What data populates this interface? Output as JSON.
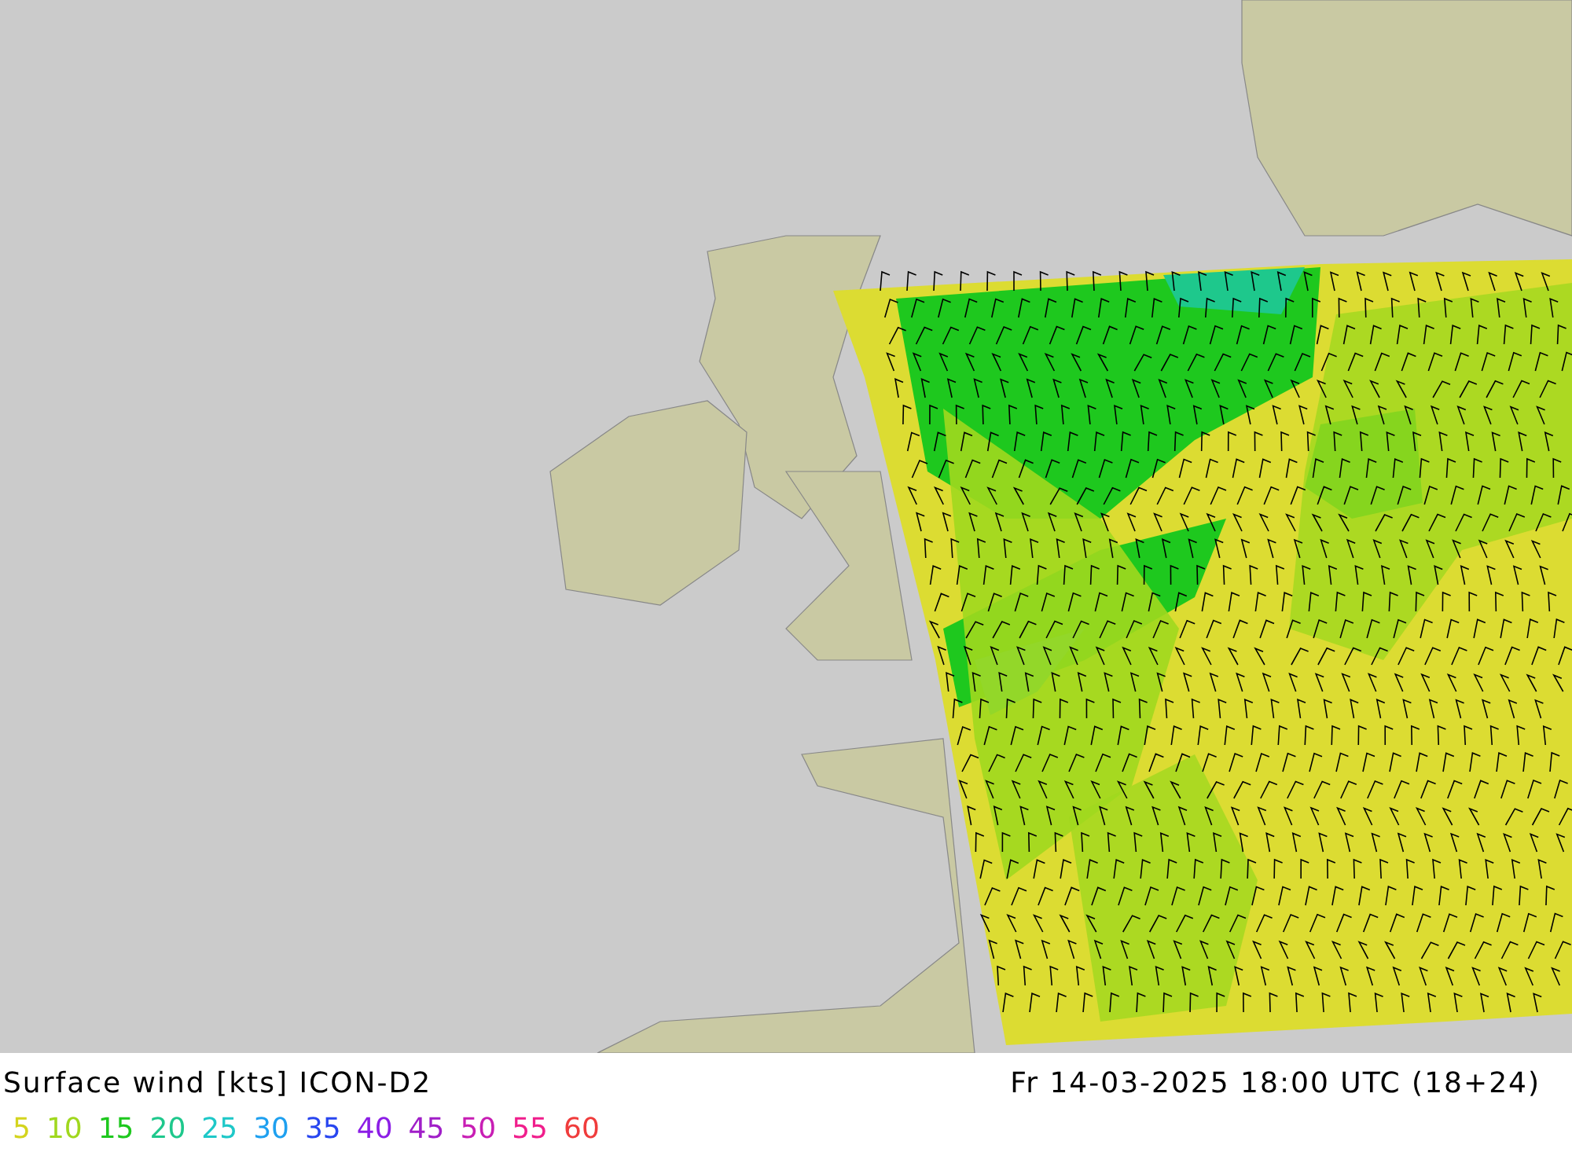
{
  "map": {
    "title": "Surface wind [kts] ICON-D2",
    "valid_time": "Fr 14-03-2025 18:00 UTC (18+24)"
  },
  "legend": [
    {
      "label": "5",
      "color": "#d4d41e"
    },
    {
      "label": "10",
      "color": "#a0d81e"
    },
    {
      "label": "15",
      "color": "#1ec81e"
    },
    {
      "label": "20",
      "color": "#1ec88c"
    },
    {
      "label": "25",
      "color": "#1ec8c8"
    },
    {
      "label": "30",
      "color": "#1ea0f0"
    },
    {
      "label": "35",
      "color": "#2846f0"
    },
    {
      "label": "40",
      "color": "#8c1ee6"
    },
    {
      "label": "45",
      "color": "#a01ec8"
    },
    {
      "label": "50",
      "color": "#c81eb4"
    },
    {
      "label": "55",
      "color": "#f01e8c"
    },
    {
      "label": "60",
      "color": "#f03c3c"
    }
  ]
}
